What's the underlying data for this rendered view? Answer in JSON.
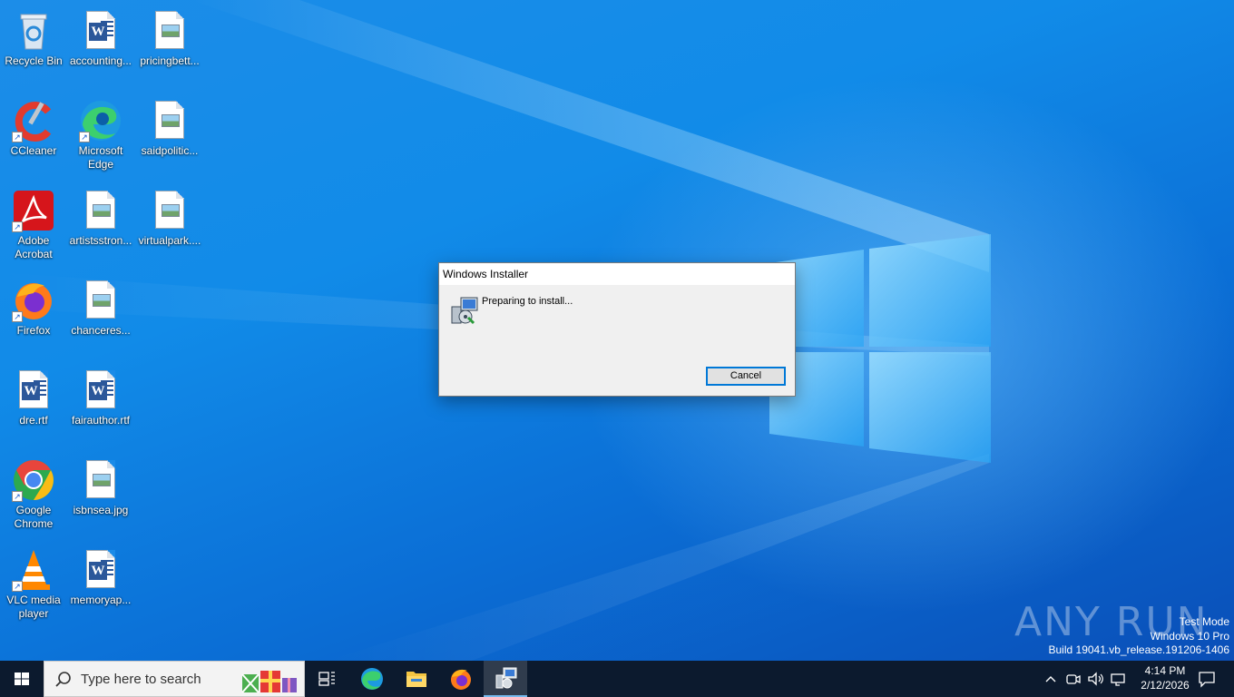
{
  "desktop": {
    "icons": [
      {
        "label": "Recycle Bin",
        "icon": "recycle-bin-icon"
      },
      {
        "label": "accounting...",
        "icon": "word-document-icon"
      },
      {
        "label": "pricingbett...",
        "icon": "image-file-icon"
      },
      {
        "label": "CCleaner",
        "icon": "ccleaner-icon"
      },
      {
        "label": "Microsoft Edge",
        "icon": "edge-icon"
      },
      {
        "label": "saidpolitic...",
        "icon": "image-file-icon"
      },
      {
        "label": "Adobe Acrobat",
        "icon": "acrobat-icon"
      },
      {
        "label": "artistsstron...",
        "icon": "image-file-icon"
      },
      {
        "label": "virtualpark....",
        "icon": "image-file-icon"
      },
      {
        "label": "Firefox",
        "icon": "firefox-icon"
      },
      {
        "label": "chanceres...",
        "icon": "image-file-icon"
      },
      {
        "label": "dre.rtf",
        "icon": "word-document-icon"
      },
      {
        "label": "fairauthor.rtf",
        "icon": "word-document-icon"
      },
      {
        "label": "Google Chrome",
        "icon": "chrome-icon"
      },
      {
        "label": "isbnsea.jpg",
        "icon": "image-file-icon"
      },
      {
        "label": "VLC media player",
        "icon": "vlc-icon"
      },
      {
        "label": "memoryap...",
        "icon": "word-document-icon"
      }
    ]
  },
  "dialog": {
    "title": "Windows Installer",
    "message": "Preparing to install...",
    "cancel_label": "Cancel"
  },
  "watermark": {
    "brand": "ANY RUN",
    "line1": "Test Mode",
    "line2": "Windows 10 Pro",
    "line3": "Build 19041.vb_release.191206-1406"
  },
  "taskbar": {
    "search_placeholder": "Type here to search",
    "time": "4:14 PM",
    "date": "2/12/2026",
    "accent": "#76b9ed"
  }
}
